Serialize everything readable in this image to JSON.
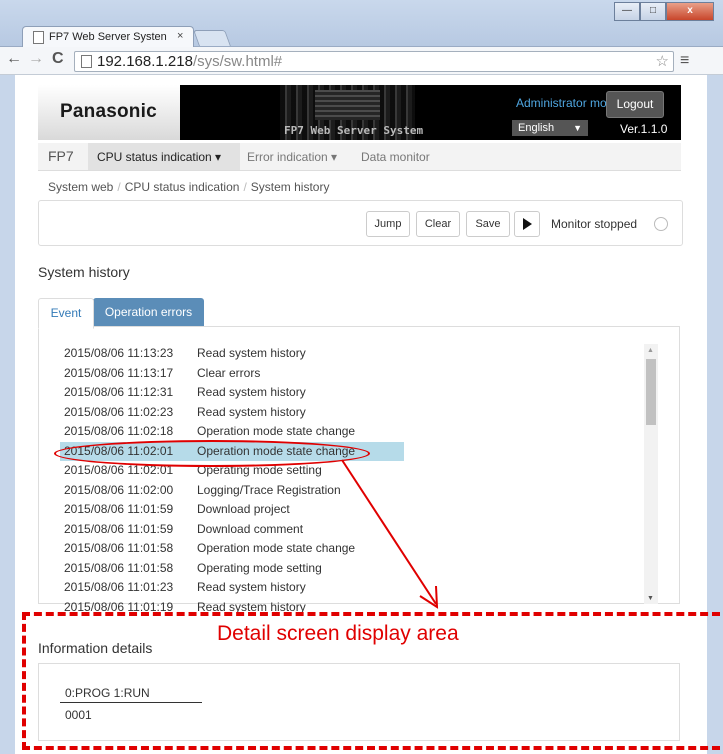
{
  "browser": {
    "tab_title": "FP7 Web Server Systen",
    "tab_close": "×",
    "url_domain": "192.168.1.218",
    "url_path": "/sys/sw.html#",
    "win_min": "—",
    "win_max": "□",
    "win_close": "x"
  },
  "header": {
    "logo": "Panasonic",
    "system_title": "FP7 Web Server System",
    "mode": "Administrator mode",
    "logout": "Logout",
    "language": "English",
    "version": "Ver.1.1.0"
  },
  "nav": {
    "brand": "FP7",
    "items": [
      {
        "label": "CPU status indication ▾"
      },
      {
        "label": "Error indication ▾"
      },
      {
        "label": "Data monitor"
      }
    ]
  },
  "breadcrumb": [
    "System web",
    "CPU status indication",
    "System history"
  ],
  "toolbar": {
    "jump": "Jump",
    "clear": "Clear",
    "save": "Save",
    "monitor_status": "Monitor stopped"
  },
  "history": {
    "title": "System history",
    "tabs": [
      "Event",
      "Operation errors"
    ],
    "rows": [
      {
        "datetime": "2015/08/06 11:13:23",
        "event": "Read system history"
      },
      {
        "datetime": "2015/08/06 11:13:17",
        "event": "Clear errors"
      },
      {
        "datetime": "2015/08/06 11:12:31",
        "event": "Read system history"
      },
      {
        "datetime": "2015/08/06 11:02:23",
        "event": "Read system history"
      },
      {
        "datetime": "2015/08/06 11:02:18",
        "event": "Operation mode state change"
      },
      {
        "datetime": "2015/08/06 11:02:01",
        "event": "Operation mode state change"
      },
      {
        "datetime": "2015/08/06 11:02:01",
        "event": "Operating mode setting"
      },
      {
        "datetime": "2015/08/06 11:02:00",
        "event": "Logging/Trace Registration"
      },
      {
        "datetime": "2015/08/06 11:01:59",
        "event": "Download project"
      },
      {
        "datetime": "2015/08/06 11:01:59",
        "event": "Download comment"
      },
      {
        "datetime": "2015/08/06 11:01:58",
        "event": "Operation mode state change"
      },
      {
        "datetime": "2015/08/06 11:01:58",
        "event": "Operating mode setting"
      },
      {
        "datetime": "2015/08/06 11:01:23",
        "event": "Read system history"
      },
      {
        "datetime": "2015/08/06 11:01:19",
        "event": "Read system history"
      }
    ],
    "selected_index": 5
  },
  "details": {
    "title": "Information details",
    "key": "0:PROG 1:RUN",
    "value": "0001"
  },
  "annotation": {
    "label": "Detail screen display area",
    "color": "#e00000"
  }
}
